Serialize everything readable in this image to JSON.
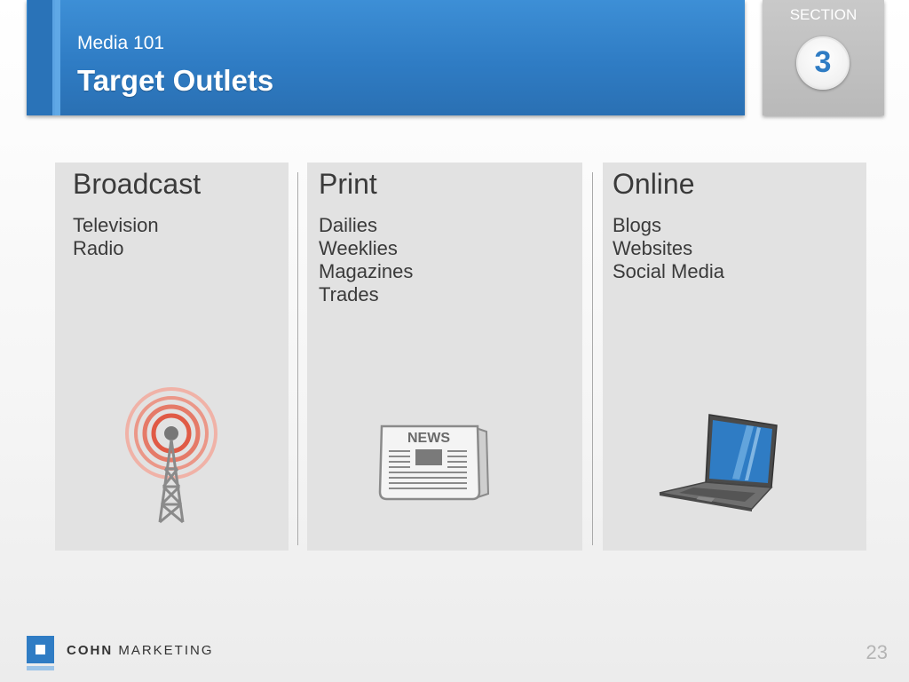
{
  "header": {
    "subtitle": "Media 101",
    "title": "Target Outlets"
  },
  "section": {
    "label": "SECTION",
    "number": "3"
  },
  "panels": [
    {
      "title": "Broadcast",
      "items": [
        "Television",
        "Radio"
      ],
      "icon": "radio-tower-icon"
    },
    {
      "title": "Print",
      "items": [
        "Dailies",
        "Weeklies",
        "Magazines",
        "Trades"
      ],
      "icon": "newspaper-icon",
      "icon_text": "NEWS"
    },
    {
      "title": "Online",
      "items": [
        "Blogs",
        "Websites",
        "Social Media"
      ],
      "icon": "laptop-icon"
    }
  ],
  "footer": {
    "brand_bold": "COHN",
    "brand_rest": "MARKETING",
    "page_number": "23"
  },
  "colors": {
    "accent_blue": "#2f7cc4",
    "panel_gray": "#e2e2e2",
    "signal_red": "#e05a45"
  }
}
